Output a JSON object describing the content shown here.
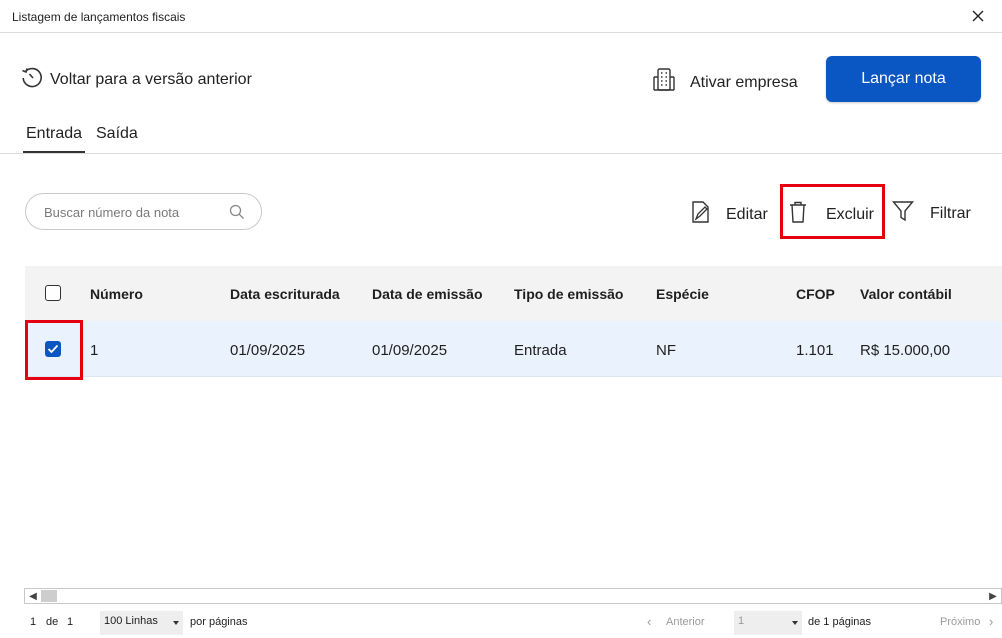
{
  "window": {
    "title": "Listagem de lançamentos fiscais"
  },
  "topbar": {
    "back_label": "Voltar para a versão anterior",
    "ativar_label": "Ativar empresa",
    "lancar_label": "Lançar nota"
  },
  "tabs": [
    {
      "label": "Entrada",
      "active": true
    },
    {
      "label": "Saída",
      "active": false
    }
  ],
  "search": {
    "placeholder": "Buscar número da nota",
    "value": ""
  },
  "actions": {
    "editar": "Editar",
    "excluir": "Excluir",
    "filtrar": "Filtrar"
  },
  "table": {
    "headers": [
      "Número",
      "Data escriturada",
      "Data de emissão",
      "Tipo de emissão",
      "Espécie",
      "CFOP",
      "Valor contábil"
    ],
    "rows": [
      {
        "checked": true,
        "cells": [
          "1",
          "01/09/2025",
          "01/09/2025",
          "Entrada",
          "NF",
          "1.101",
          "R$ 15.000,00"
        ]
      }
    ]
  },
  "pagination": {
    "current": "1",
    "de": "de",
    "total": "1",
    "rows_per_page": "100 Linhas",
    "por_paginas": "por páginas",
    "anterior": "Anterior",
    "page_select": "1",
    "de_paginas": "de 1 páginas",
    "proximo": "Próximo"
  },
  "colors": {
    "accent": "#0a56c2",
    "highlight_border": "#e4000f",
    "selected_row": "#eaf2fd"
  }
}
